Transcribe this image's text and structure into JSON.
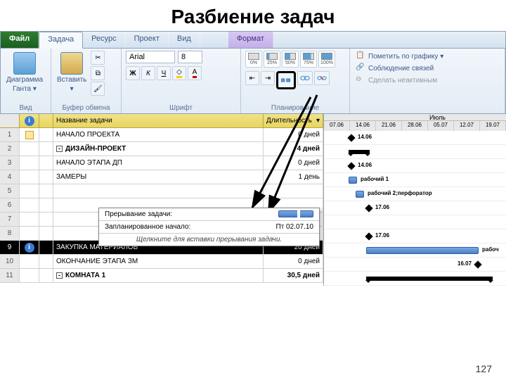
{
  "slide": {
    "title": "Разбиение задач",
    "page_number": "127"
  },
  "ribbon": {
    "tabs": {
      "file": "Файл",
      "task": "Задача",
      "resource": "Ресурс",
      "project": "Проект",
      "view": "Вид",
      "format": "Формат"
    },
    "groups": {
      "view": "Вид",
      "clipboard": "Буфер обмена",
      "font": "Шрифт",
      "planning": "Планирование"
    },
    "gantt_btn": {
      "l1": "Диаграмма",
      "l2": "Ганта ▾"
    },
    "paste_btn": "Вставить",
    "font_name": "Arial",
    "font_size": "8",
    "bold": "Ж",
    "italic": "К",
    "underline": "Ч",
    "pct": [
      "0%",
      "25%",
      "50%",
      "75%",
      "100%"
    ],
    "plan": {
      "mark": "Пометить по графику ▾",
      "links": "Соблюдение связей",
      "inactive": "Сделать неактивным"
    }
  },
  "table": {
    "headers": {
      "name": "Название задачи",
      "duration": "Длительность"
    },
    "rows": [
      {
        "n": "1",
        "name": "НАЧАЛО ПРОЕКТА",
        "dur": "0 дней",
        "bold": false,
        "info": "note"
      },
      {
        "n": "2",
        "name": "ДИЗАЙН-ПРОЕКТ",
        "dur": "4 дней",
        "bold": true,
        "outline": "-"
      },
      {
        "n": "3",
        "name": "НАЧАЛО ЭТАПА ДП",
        "dur": "0 дней",
        "bold": false
      },
      {
        "n": "4",
        "name": "ЗАМЕРЫ",
        "dur": "1 день",
        "bold": false
      },
      {
        "n": "5",
        "name": "",
        "dur": "",
        "bold": false
      },
      {
        "n": "6",
        "name": "",
        "dur": "",
        "bold": false
      },
      {
        "n": "7",
        "name": "",
        "dur": "",
        "bold": false
      },
      {
        "n": "8",
        "name": "",
        "dur": "",
        "bold": false
      },
      {
        "n": "9",
        "name": "ЗАКУПКА МАТЕРИАЛОВ",
        "dur": "20 дней",
        "bold": false,
        "selected": true,
        "info": "i"
      },
      {
        "n": "10",
        "name": "ОКОНЧАНИЕ ЭТАПА ЗМ",
        "dur": "0 дней",
        "bold": false
      },
      {
        "n": "11",
        "name": "КОМНАТА 1",
        "dur": "30,5 дней",
        "bold": true,
        "outline": "-"
      }
    ]
  },
  "gantt": {
    "month": "Июль",
    "dates": [
      "07.06",
      "14.06",
      "21.06",
      "28.06",
      "05.07",
      "12.07",
      "19.07"
    ],
    "labels": {
      "d14_06": "14.06",
      "d17_06": "17.06",
      "d16_07": "16.07",
      "w1": "рабочий 1",
      "w2": "рабочий 2;перфоратор",
      "partial": "рабоч"
    }
  },
  "tooltip": {
    "title": "Прерывание задачи:",
    "plan_label": "Запланированное начало:",
    "plan_value": "Пт 02.07.10",
    "hint": "Щелкните для вставки прерывания задачи."
  }
}
